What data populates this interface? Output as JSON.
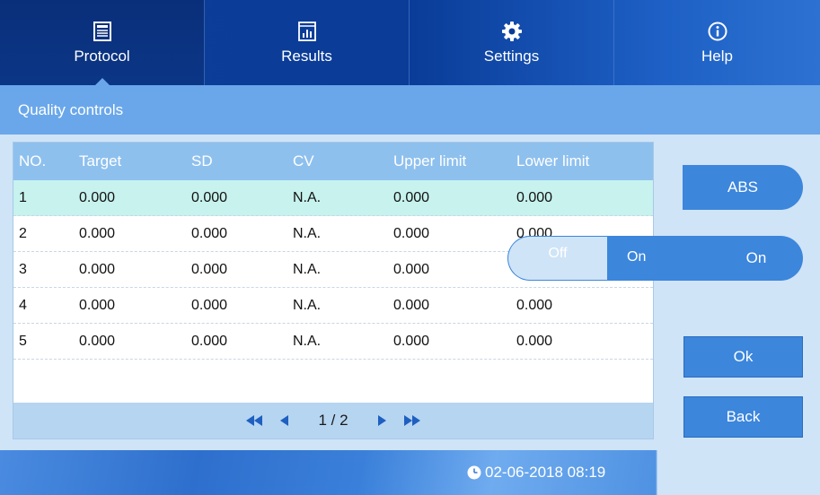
{
  "nav": {
    "tabs": [
      {
        "label": "Protocol",
        "icon": "protocol-icon",
        "active": true
      },
      {
        "label": "Results",
        "icon": "results-icon",
        "active": false
      },
      {
        "label": "Settings",
        "icon": "gear-icon",
        "active": false
      },
      {
        "label": "Help",
        "icon": "info-icon",
        "active": false
      }
    ]
  },
  "page": {
    "title": "Quality controls"
  },
  "table": {
    "columns": [
      "NO.",
      "Target",
      "SD",
      "CV",
      "Upper limit",
      "Lower limit"
    ],
    "rows": [
      {
        "no": "1",
        "target": "0.000",
        "sd": "0.000",
        "cv": "N.A.",
        "upper": "0.000",
        "lower": "0.000",
        "selected": true
      },
      {
        "no": "2",
        "target": "0.000",
        "sd": "0.000",
        "cv": "N.A.",
        "upper": "0.000",
        "lower": "0.000",
        "selected": false
      },
      {
        "no": "3",
        "target": "0.000",
        "sd": "0.000",
        "cv": "N.A.",
        "upper": "0.000",
        "lower": "",
        "selected": false
      },
      {
        "no": "4",
        "target": "0.000",
        "sd": "0.000",
        "cv": "N.A.",
        "upper": "0.000",
        "lower": "0.000",
        "selected": false
      },
      {
        "no": "5",
        "target": "0.000",
        "sd": "0.000",
        "cv": "N.A.",
        "upper": "0.000",
        "lower": "0.000",
        "selected": false
      }
    ]
  },
  "pager": {
    "text": "1 / 2"
  },
  "buttons": {
    "abs": "ABS",
    "on": "On",
    "ok": "Ok",
    "back": "Back"
  },
  "toggle": {
    "off": "Off",
    "on": "On"
  },
  "status": {
    "datetime": "02-06-2018 08:19",
    "icon": "clock-icon"
  },
  "colors": {
    "nav_bg": "#0a3c98",
    "title_bar": "#6aa7ea",
    "table_header": "#8ec0ee",
    "selected_row": "#c7f2ee",
    "button": "#3c86dc",
    "panel_bg": "#cfe4f7"
  }
}
